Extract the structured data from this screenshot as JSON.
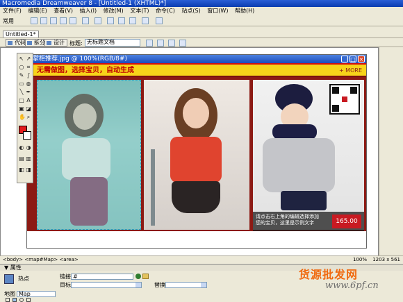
{
  "window": {
    "title": "Macromedia Dreamweaver 8 - [Untitled-1 (XHTML)*]"
  },
  "menu": [
    "文件(F)",
    "编辑(E)",
    "查看(V)",
    "插入(I)",
    "修改(M)",
    "文本(T)",
    "命令(C)",
    "站点(S)",
    "窗口(W)",
    "帮助(H)"
  ],
  "toolbar": {
    "category": "常用"
  },
  "tabs": {
    "document": "Untitled-1*"
  },
  "viewbar": {
    "code": "代码",
    "split": "拆分",
    "design": "设计",
    "title_label": "标题:",
    "title_value": "无标题文档"
  },
  "image_window": {
    "title": "掌柜推荐.jpg @ 100%(RGB/8#)",
    "banner": "无需做图，选择宝贝，自动生成",
    "more": "+ MORE",
    "price_note": "请点击右上角的编辑选择添加您的宝贝，这里是示例文字",
    "price": "165.00"
  },
  "status": {
    "path": "<body> <map#Map> <area>",
    "zoom": "100%",
    "size": "1203 x 561"
  },
  "properties": {
    "header": "▼ 属性",
    "hotspot_label": "热点",
    "link_label": "链接",
    "link_value": "#",
    "target_label": "目标",
    "replace_label": "替换",
    "map_label": "地图",
    "map_value": "Map"
  },
  "watermark": {
    "brand": "货源批发网",
    "site": "www.6pf.cn"
  },
  "colors": {
    "banner_bg": "#f7d41a",
    "banner_text": "#c00000",
    "price_bg": "#c81a22",
    "frame": "#8c1a14"
  }
}
